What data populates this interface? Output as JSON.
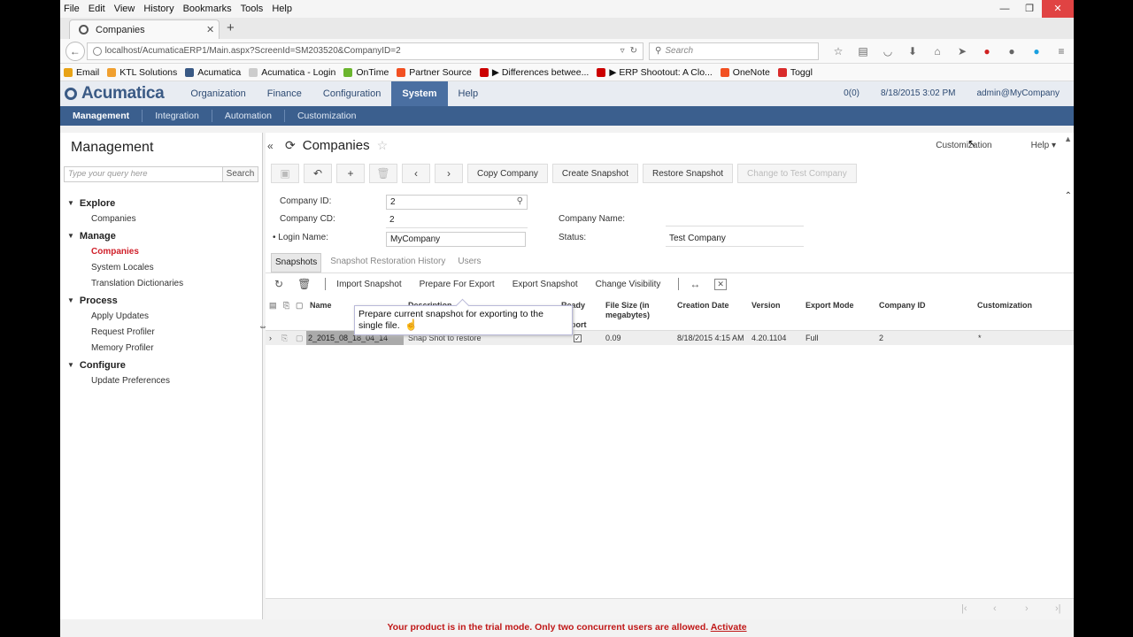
{
  "browser": {
    "menu": [
      "File",
      "Edit",
      "View",
      "History",
      "Bookmarks",
      "Tools",
      "Help"
    ],
    "tab_title": "Companies",
    "url": "localhost/AcumaticaERP1/Main.aspx?ScreenId=SM203520&CompanyID=2",
    "search_placeholder": "Search",
    "bookmarks": [
      {
        "label": "Email",
        "color": "#e8a317"
      },
      {
        "label": "KTL Solutions",
        "color": "#f0a030"
      },
      {
        "label": "Acumatica",
        "color": "#3a5a85"
      },
      {
        "label": "Acumatica - Login",
        "color": "#cccccc"
      },
      {
        "label": "OnTime",
        "color": "#6bb52e"
      },
      {
        "label": "Partner Source",
        "color": "#f25022"
      },
      {
        "label": "▶ Differences betwee...",
        "color": "#cc0000"
      },
      {
        "label": "▶ ERP Shootout: A Clo...",
        "color": "#cc0000"
      },
      {
        "label": "OneNote",
        "color": "#f25022"
      },
      {
        "label": "Toggl",
        "color": "#d92b2b"
      }
    ]
  },
  "app": {
    "logo": "Acumatica",
    "topnav": [
      "Organization",
      "Finance",
      "Configuration",
      "System",
      "Help"
    ],
    "topnav_active": "System",
    "notifications": "0(0)",
    "datetime": "8/18/2015  3:02 PM",
    "user": "admin@MyCompany",
    "subnav": [
      "Management",
      "Integration",
      "Automation",
      "Customization"
    ]
  },
  "sidebar": {
    "title": "Management",
    "search_placeholder": "Type your query here",
    "search_button": "Search",
    "groups": [
      {
        "label": "Explore",
        "items": [
          "Companies"
        ]
      },
      {
        "label": "Manage",
        "items": [
          "Companies",
          "System Locales",
          "Translation Dictionaries"
        ]
      },
      {
        "label": "Process",
        "items": [
          "Apply Updates",
          "Request Profiler",
          "Memory Profiler"
        ]
      },
      {
        "label": "Configure",
        "items": [
          "Update Preferences"
        ]
      }
    ],
    "selected": "Manage/Companies"
  },
  "main": {
    "title": "Companies",
    "customization": "Customization",
    "help": "Help",
    "toolbar": [
      "Copy Company",
      "Create Snapshot",
      "Restore Snapshot",
      "Change to Test Company"
    ],
    "form": {
      "company_id_label": "Company ID:",
      "company_id": "2",
      "company_cd_label": "Company CD:",
      "company_cd": "2",
      "login_name_label": "Login Name:",
      "login_name": "MyCompany",
      "company_name_label": "Company Name:",
      "status_label": "Status:",
      "status": "Test Company"
    },
    "tabs": [
      "Snapshots",
      "Snapshot Restoration History",
      "Users"
    ],
    "grid_toolbar": [
      "Import Snapshot",
      "Prepare For Export",
      "Export Snapshot",
      "Change Visibility"
    ],
    "columns": {
      "name": "Name",
      "description": "Description",
      "ready": "Ready for Export",
      "filesize": "File Size (in megabytes)",
      "created": "Creation Date",
      "version": "Version",
      "export_mode": "Export Mode",
      "company_id": "Company ID",
      "customization": "Customization"
    },
    "row": {
      "name": "2_2015_08_18_04_14",
      "description": "Snap Shot to restore",
      "filesize": "0.09",
      "created": "8/18/2015 4:15 AM",
      "version": "4.20.1104",
      "export_mode": "Full",
      "company_id": "2",
      "customization": "*"
    },
    "tooltip": "Prepare current snapshot for exporting to the single file."
  },
  "footer": {
    "message": "Your product is in the trial mode. Only two concurrent users are allowed.",
    "link": "Activate"
  }
}
